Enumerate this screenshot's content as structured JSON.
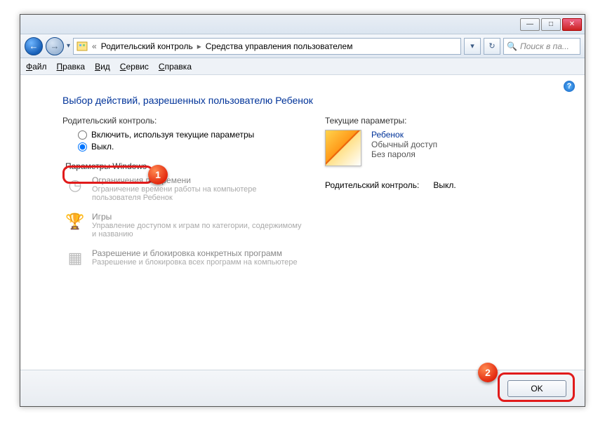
{
  "titlebar": {
    "minimize": "—",
    "maximize": "□",
    "close": "✕"
  },
  "nav": {
    "back": "←",
    "forward": "→",
    "dropdown": "▾",
    "refresh": "↻"
  },
  "breadcrumb": {
    "prefix": "«",
    "item1": "Родительский контроль",
    "item2": "Средства управления пользователем"
  },
  "search": {
    "placeholder": "Поиск в па..."
  },
  "menu": {
    "file": "айл",
    "edit": "равка",
    "view": "ид",
    "tools": "ервис",
    "help": "правка"
  },
  "page": {
    "title": "Выбор действий, разрешенных пользователю Ребенок",
    "section_pc": "Родительский контроль:",
    "radio_on": "Включить, используя текущие параметры",
    "radio_off": "Выкл.",
    "section_win": "Параметры Windows",
    "opt1_title": "Ограничения по времени",
    "opt1_desc": "Ограничение времени работы на компьютере пользователя Ребенок",
    "opt2_title": "Игры",
    "opt2_desc": "Управление доступом к играм по категории, содержимому и названию",
    "opt3_title": "Разрешение и блокировка конкретных программ",
    "opt3_desc": "Разрешение и блокировка всех программ на компьютере"
  },
  "right": {
    "section": "Текущие параметры:",
    "username": "Ребенок",
    "usertype": "Обычный доступ",
    "userpw": "Без пароля",
    "status_label": "Родительский контроль:",
    "status_value": "Выкл."
  },
  "footer": {
    "ok": "OK"
  },
  "annotations": {
    "badge1": "1",
    "badge2": "2"
  },
  "icons": {
    "clock": "◷",
    "trophy": "🏆",
    "blocks": "▦",
    "help": "?",
    "search": "🔍"
  }
}
